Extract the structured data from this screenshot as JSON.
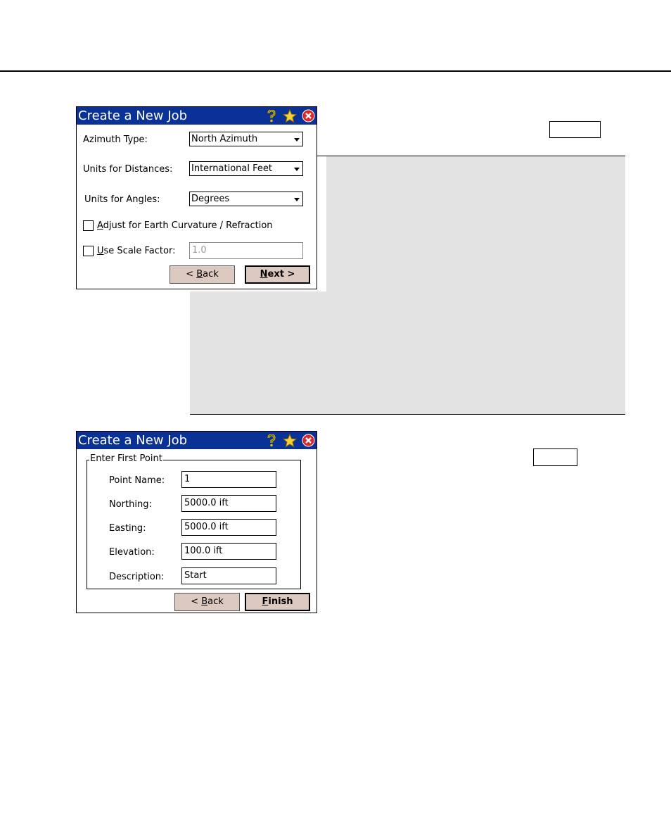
{
  "dialog1": {
    "title": "Create a New Job",
    "azimuth_label": "Azimuth Type:",
    "azimuth_value": "North Azimuth",
    "dist_label": "Units for Distances:",
    "dist_value": "International Feet",
    "angles_label": "Units for Angles:",
    "angles_value": "Degrees",
    "curv_accel": "A",
    "curv_rest": "djust for Earth Curvature / Refraction",
    "curv_checked": false,
    "scale_accel": "U",
    "scale_rest": "se Scale Factor:",
    "scale_checked": false,
    "scale_value": "1.0",
    "back_prefix": "< ",
    "back_accel": "B",
    "back_rest": "ack",
    "next_accel": "N",
    "next_rest": "ext >"
  },
  "dialog2": {
    "title": "Create a New Job",
    "group_label": "Enter First Point",
    "point_name_label": "Point Name:",
    "point_name_value": "1",
    "northing_label": "Northing:",
    "northing_value": "5000.0 ift",
    "easting_label": "Easting:",
    "easting_value": "5000.0 ift",
    "elevation_label": "Elevation:",
    "elevation_value": "100.0 ift",
    "description_label": "Description:",
    "description_value": "Start",
    "back_prefix": "< ",
    "back_accel": "B",
    "back_rest": "ack",
    "finish_accel": "F",
    "finish_rest": "inish"
  },
  "icons": [
    "help-icon",
    "star-icon",
    "close-icon"
  ],
  "colors": {
    "titlebar": "#0a3296",
    "button": "#dcc9bf",
    "panel": "#e3e3e3",
    "close": "#d8282a"
  }
}
